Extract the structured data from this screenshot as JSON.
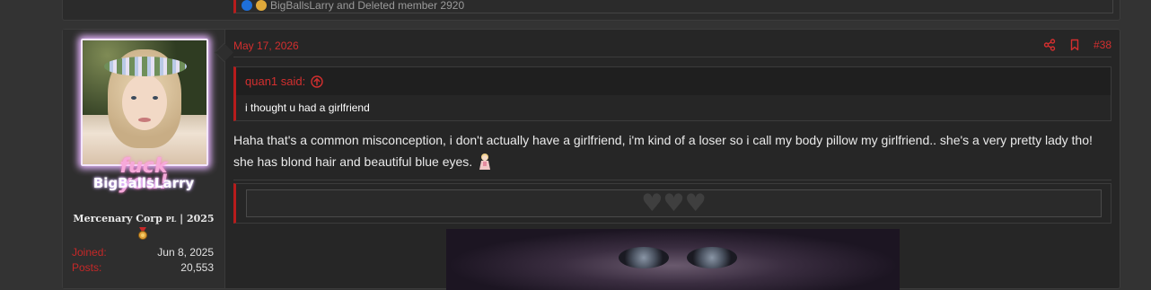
{
  "previous_post": {
    "reactions_text": "BigBallsLarry and Deleted member 2920"
  },
  "post": {
    "date": "May 17, 2026",
    "number": "#38",
    "user": {
      "avatar_overlay_line1": "fuck",
      "avatar_overlay_line2": "you!",
      "username": "BigBallsLarry",
      "title": "Mercenary Corp",
      "title_suffix": "PL",
      "title_year": "| 2025",
      "stats": [
        {
          "label": "Joined:",
          "value": "Jun 8, 2025"
        },
        {
          "label": "Posts:",
          "value": "20,553"
        }
      ]
    },
    "quote": {
      "author": "quan1 said:",
      "text": "i thought u had a girlfriend"
    },
    "message": "Haha that's a common misconception, i don't actually have a girlfriend, i'm kind of a loser so i call my body pillow my girlfriend.. she's a very pretty lady tho! she has blond hair and beautiful blue eyes.",
    "signature_hearts": "♥♥♥"
  },
  "colors": {
    "accent": "#d32f2f",
    "background": "#333333",
    "panel": "#262626",
    "user_panel": "#2e2e2e"
  },
  "icons": [
    "share-icon",
    "bookmark-icon",
    "arrow-up-circle-icon",
    "medal-icon",
    "emoji-icon"
  ]
}
